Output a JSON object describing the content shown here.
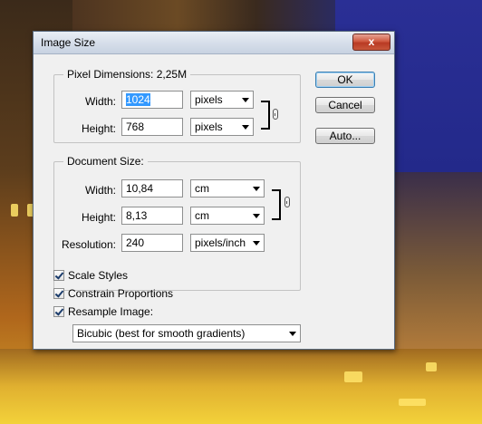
{
  "dialog": {
    "title": "Image Size",
    "close_label": "x"
  },
  "pixel_dimensions": {
    "group_label": "Pixel Dimensions:",
    "size_value": "2,25M",
    "width_label": "Width:",
    "width_value": "1024",
    "width_unit": "pixels",
    "height_label": "Height:",
    "height_value": "768",
    "height_unit": "pixels"
  },
  "document_size": {
    "group_label": "Document Size:",
    "width_label": "Width:",
    "width_value": "10,84",
    "width_unit": "cm",
    "height_label": "Height:",
    "height_value": "8,13",
    "height_unit": "cm",
    "resolution_label": "Resolution:",
    "resolution_value": "240",
    "resolution_unit": "pixels/inch"
  },
  "options": {
    "scale_styles": {
      "label": "Scale Styles",
      "checked": true
    },
    "constrain_proportions": {
      "label": "Constrain Proportions",
      "checked": true
    },
    "resample_image": {
      "label": "Resample Image:",
      "checked": true
    },
    "resample_method": "Bicubic (best for smooth gradients)"
  },
  "buttons": {
    "ok": "OK",
    "cancel": "Cancel",
    "auto": "Auto..."
  }
}
